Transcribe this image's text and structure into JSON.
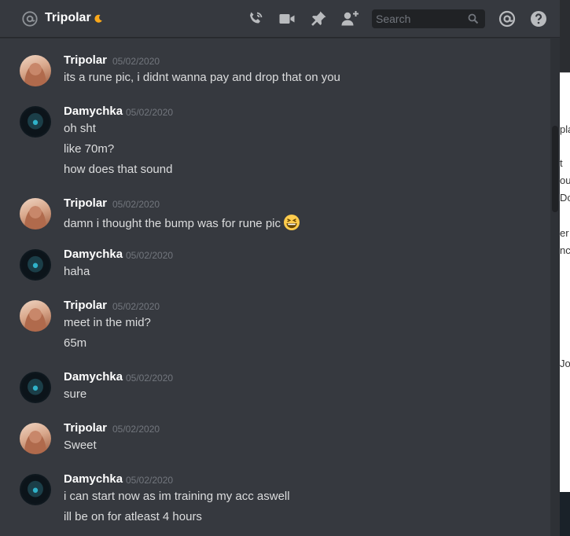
{
  "header": {
    "title": "Tripolar",
    "search_placeholder": "Search",
    "icons": [
      "at-icon",
      "moon-icon",
      "call-icon",
      "video-icon",
      "pin-icon",
      "add-friend-icon",
      "search-icon",
      "mention-icon",
      "help-icon"
    ]
  },
  "messages": [
    {
      "author": "Tripolar",
      "avatar": "tripolar",
      "timestamp": "05/02/2020",
      "lines": [
        "its a rune pic, i didnt wanna pay and drop that on you"
      ]
    },
    {
      "author": "Damychka",
      "avatar": "damychka",
      "timestamp": "05/02/2020",
      "lines": [
        "oh sht",
        "like 70m?",
        "how does that sound"
      ]
    },
    {
      "author": "Tripolar",
      "avatar": "tripolar",
      "timestamp": "05/02/2020",
      "lines": [
        "damn i thought the bump was for rune pic"
      ],
      "emoji": "grinning-squint-emoji"
    },
    {
      "author": "Damychka",
      "avatar": "damychka",
      "timestamp": "05/02/2020",
      "lines": [
        "haha"
      ]
    },
    {
      "author": "Tripolar",
      "avatar": "tripolar",
      "timestamp": "05/02/2020",
      "lines": [
        "meet in the mid?",
        "65m"
      ]
    },
    {
      "author": "Damychka",
      "avatar": "damychka",
      "timestamp": "05/02/2020",
      "lines": [
        "sure"
      ]
    },
    {
      "author": "Tripolar",
      "avatar": "tripolar",
      "timestamp": "05/02/2020",
      "lines": [
        "Sweet"
      ]
    },
    {
      "author": "Damychka",
      "avatar": "damychka",
      "timestamp": "05/02/2020",
      "lines": [
        "i can start now as im training my acc aswell",
        "ill be on for atleast 4 hours"
      ]
    }
  ],
  "background_window": {
    "fragments": [
      "pla",
      "t",
      "ou",
      "Dc",
      "er",
      "nc",
      "Jo"
    ]
  },
  "colors": {
    "chat_bg": "#36393f",
    "text": "#dcddde",
    "username": "#ffffff",
    "timestamp": "#72767d",
    "search_bg": "#202225",
    "icon": "#b9bbbe",
    "moon": "#faa81a"
  }
}
